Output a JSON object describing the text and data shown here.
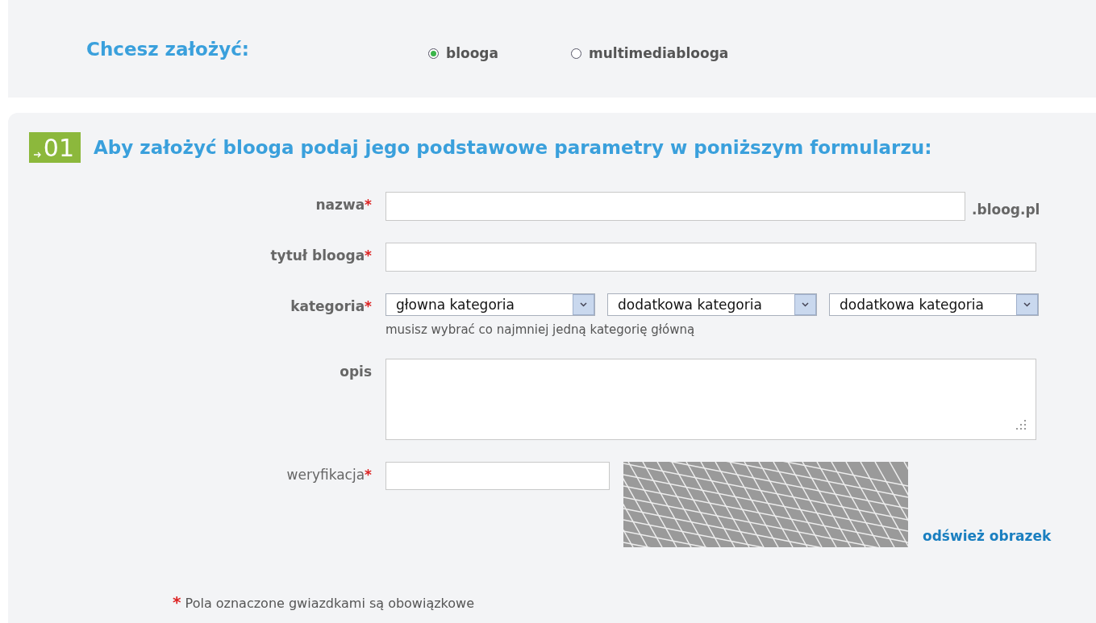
{
  "choice": {
    "title": "Chcesz założyć:",
    "options": [
      {
        "label": "blooga",
        "selected": true
      },
      {
        "label": "multimediablooga",
        "selected": false
      }
    ]
  },
  "section": {
    "badge": "01",
    "title": "Aby założyć blooga podaj jego podstawowe parametry w poniższym formularzu:"
  },
  "fields": [
    {
      "kind": "text",
      "label": "nazwa",
      "mark": "*",
      "suffix": ".bloog.pl"
    },
    {
      "kind": "text",
      "label": "tytuł blooga",
      "mark": "*"
    },
    {
      "kind": "select",
      "label": "kategoria",
      "mark": "*",
      "selects": [
        "głowna kategoria",
        "dodatkowa kategoria",
        "dodatkowa kategoria"
      ],
      "hint": "musisz wybrać co najmniej jedną kategorię główną"
    },
    {
      "kind": "textarea",
      "label": "opis"
    },
    {
      "kind": "captcha",
      "label": "weryfikacja",
      "mark": "*",
      "link": "odśwież obrazek"
    }
  ],
  "note": {
    "mark": "*",
    "text": "Pola oznaczone gwiazdkami są obowiązkowe"
  }
}
